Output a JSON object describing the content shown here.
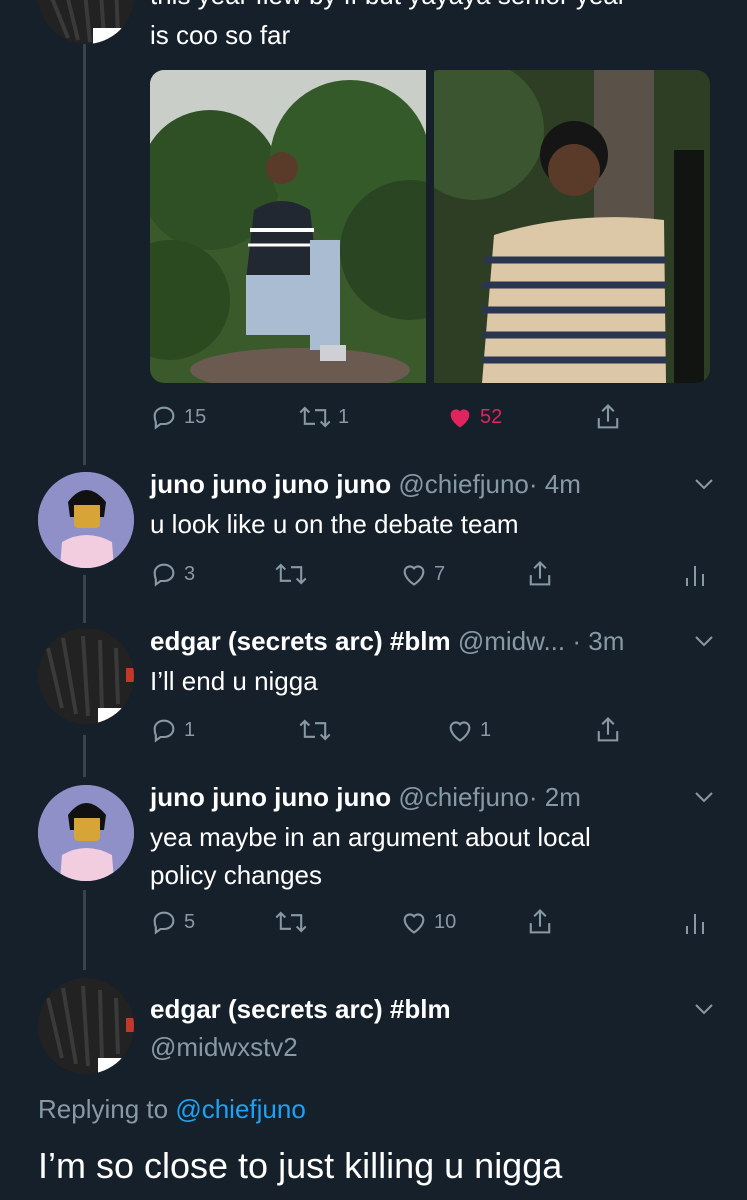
{
  "tweet_top": {
    "partial_line": "this year flew by ff but yayaya senior year",
    "line2": "is coo so far",
    "actions": {
      "replies": "15",
      "retweets": "1",
      "likes": "52"
    }
  },
  "reply1": {
    "name": "juno juno juno juno",
    "handle": "@chiefjuno",
    "time": "· 4m",
    "text": "u look like u on the debate team",
    "actions": {
      "replies": "3",
      "retweets": "",
      "likes": "7"
    }
  },
  "reply2": {
    "name": "edgar (secrets arc) #blm",
    "handle": "@midw...",
    "time": "· 3m",
    "text": "I’ll end u nigga",
    "actions": {
      "replies": "1",
      "retweets": "",
      "likes": "1"
    }
  },
  "reply3": {
    "name": "juno juno juno juno",
    "handle": "@chiefjuno",
    "time": "· 2m",
    "text_line1": "yea maybe in an argument about local",
    "text_line2": "policy changes",
    "actions": {
      "replies": "5",
      "retweets": "",
      "likes": "10"
    }
  },
  "main_tweet": {
    "name": "edgar (secrets arc) #blm",
    "handle": "@midwxstv2",
    "replying_prefix": "Replying to",
    "replying_handle": "@chiefjuno",
    "text": "I’m so close to just killing u nigga"
  },
  "colors": {
    "background": "#15202b",
    "muted": "#8899a6",
    "like_red": "#e0245e",
    "link_blue": "#1da1f2",
    "thread_line": "#38444d"
  }
}
